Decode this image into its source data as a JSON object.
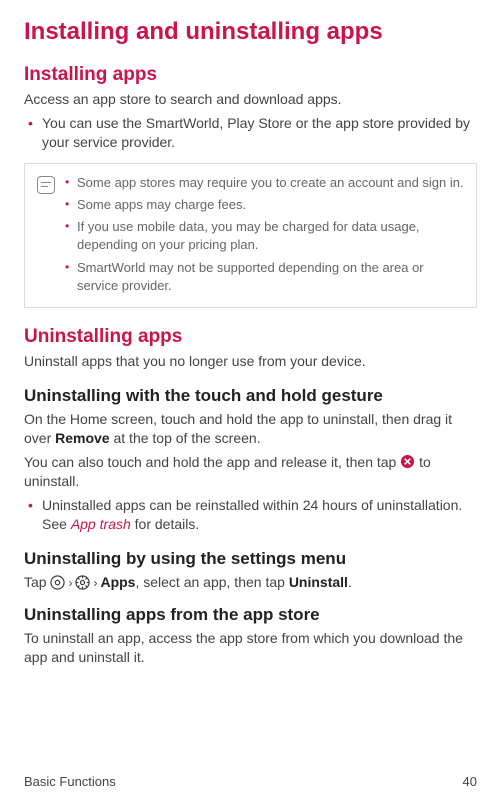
{
  "page_title": "Installing and uninstalling apps",
  "installing": {
    "heading": "Installing apps",
    "intro": "Access an app store to search and download apps.",
    "bullets": [
      "You can use the SmartWorld, Play Store or the app store provided by your service provider."
    ],
    "notes": [
      "Some app stores may require you to create an account and sign in.",
      "Some apps may charge fees.",
      "If you use mobile data, you may be charged for data usage, depending on your pricing plan.",
      "SmartWorld may not be supported depending on the area or service provider."
    ]
  },
  "uninstalling": {
    "heading": "Uninstalling apps",
    "intro": "Uninstall apps that you no longer use from your device.",
    "touch_hold": {
      "heading": "Uninstalling with the touch and hold gesture",
      "para1_before": "On the Home screen, touch and hold the app to uninstall, then drag it over ",
      "para1_bold": "Remove",
      "para1_after": " at the top of the screen.",
      "para2_before": "You can also touch and hold the app and release it, then tap ",
      "para2_after": " to uninstall.",
      "bullet_before": "Uninstalled apps can be reinstalled within 24 hours of uninstallation. See ",
      "bullet_link": "App trash",
      "bullet_after": " for details."
    },
    "settings": {
      "heading": "Uninstalling by using the settings menu",
      "tap": "Tap ",
      "chev": "›",
      "apps_bold": "Apps",
      "mid": ", select an app, then tap ",
      "uninstall_bold": "Uninstall",
      "end": "."
    },
    "store": {
      "heading": "Uninstalling apps from the app store",
      "text": "To uninstall an app, access the app store from which you download the app and uninstall it."
    }
  },
  "footer": {
    "section": "Basic Functions",
    "page": "40"
  }
}
